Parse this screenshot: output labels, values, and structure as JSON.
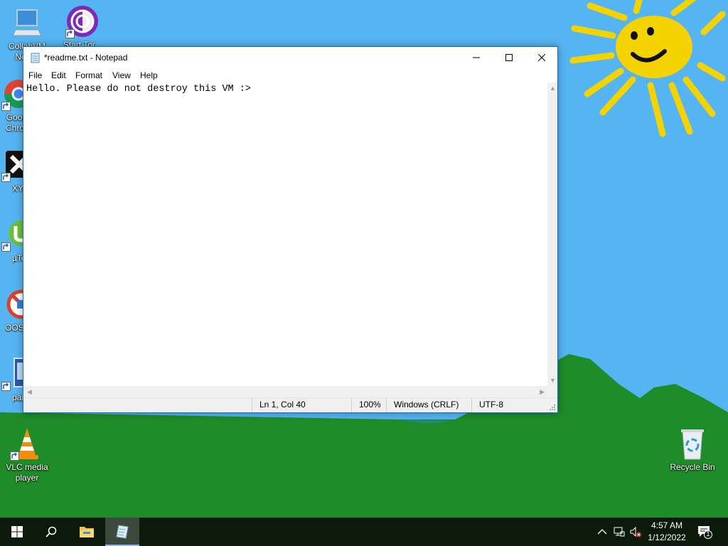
{
  "desktop": {
    "icons": [
      {
        "label": "CollabVM New..."
      },
      {
        "label": "Start Tor..."
      },
      {
        "label": "Google Chrome"
      },
      {
        "label": "XYplorer"
      },
      {
        "label": "µTorrent"
      },
      {
        "label": "OOSU"
      },
      {
        "label": "paint"
      },
      {
        "label": "VLC media player"
      },
      {
        "label": "Recycle Bin"
      }
    ]
  },
  "notepad": {
    "title": "*readme.txt - Notepad",
    "menu": [
      "File",
      "Edit",
      "Format",
      "View",
      "Help"
    ],
    "content": "Hello. Please do not destroy this VM :>",
    "status": {
      "position": "Ln 1, Col 40",
      "zoom": "100%",
      "line_ending": "Windows (CRLF)",
      "encoding": "UTF-8"
    }
  },
  "taskbar": {
    "time": "4:57 AM",
    "date": "1/12/2022",
    "notification_count": "1"
  },
  "colors": {
    "sky": "#55b4f2",
    "hills": "#1e8c28",
    "sun": "#f5d300",
    "taskbar": "#0b1a0b"
  }
}
